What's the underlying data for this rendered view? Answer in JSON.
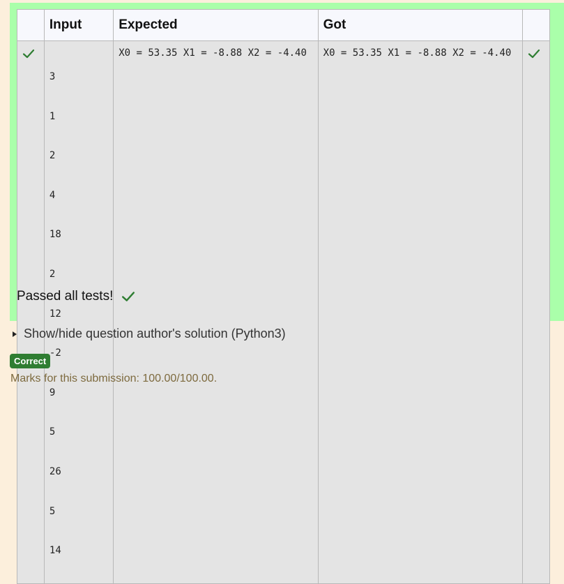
{
  "table": {
    "headers": {
      "check": "",
      "input": "Input",
      "expected": "Expected",
      "got": "Got",
      "result": ""
    },
    "row": {
      "input_lines": [
        "3",
        "1",
        "2",
        "4",
        "18",
        "2",
        "12",
        "-2",
        "9",
        "5",
        "26",
        "5",
        "14"
      ],
      "expected": "X0 = 53.35 X1 = -8.88 X2 = -4.40",
      "got": "X0 = 53.35 X1 = -8.88 X2 = -4.40",
      "status_icon": "check-icon"
    }
  },
  "summary": {
    "passed_text": "Passed all tests!",
    "passed_icon": "check-icon"
  },
  "solution_toggle": {
    "label": "Show/hide question author's solution (Python3)"
  },
  "grade": {
    "badge": "Correct",
    "marks": "Marks for this submission: 100.00/100.00."
  },
  "colors": {
    "page_background": "#fcefdc",
    "results_background": "#aaffaa",
    "check_green": "#2e7d32",
    "badge_green": "#2f7d32"
  }
}
